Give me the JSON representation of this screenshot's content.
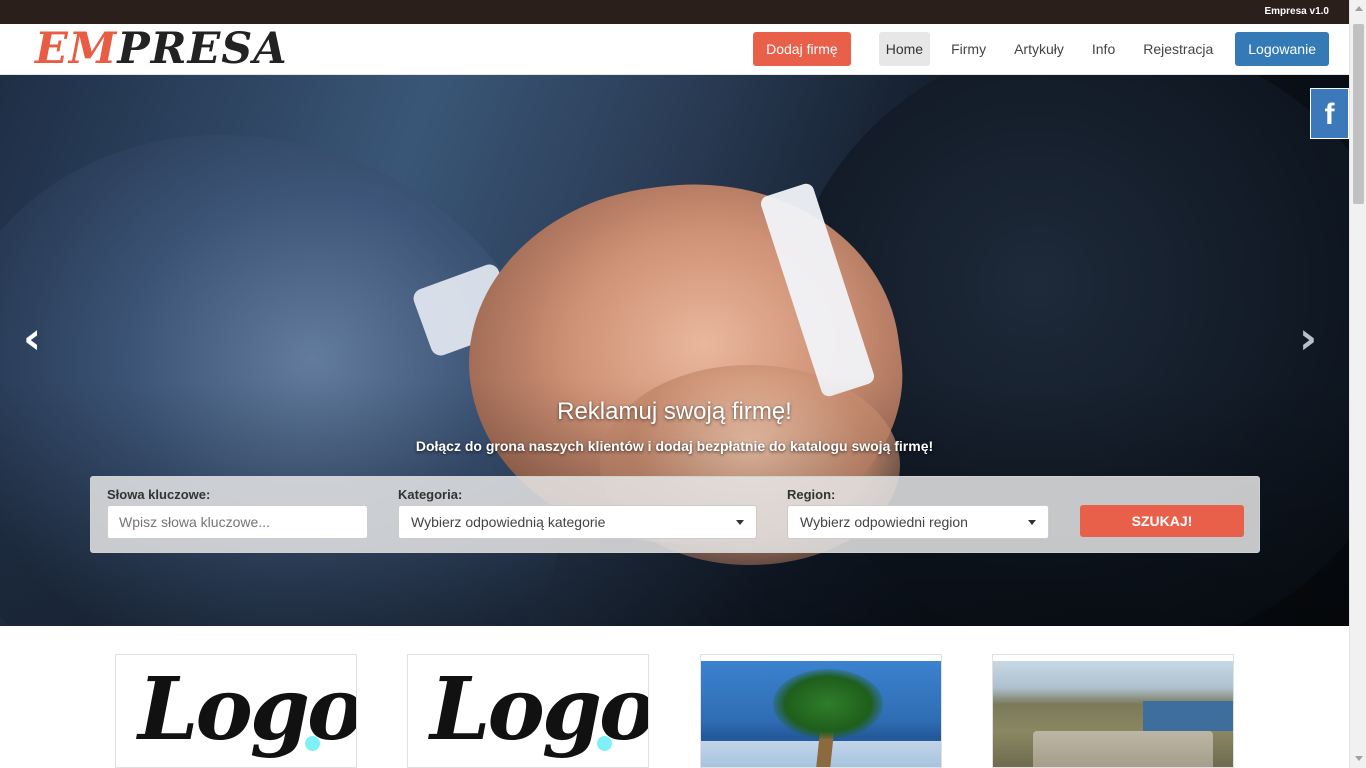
{
  "topbar": {
    "version": "Empresa v1.0"
  },
  "brand": {
    "part1": "EM",
    "part2": "PRESA"
  },
  "nav": {
    "add_company": "Dodaj firmę",
    "items": [
      {
        "label": "Home",
        "active": true
      },
      {
        "label": "Firmy",
        "active": false
      },
      {
        "label": "Artykuły",
        "active": false
      },
      {
        "label": "Info",
        "active": false
      },
      {
        "label": "Rejestracja",
        "active": false
      }
    ],
    "login": "Logowanie"
  },
  "social": {
    "facebook_icon": "f"
  },
  "carousel": {
    "prev_icon": "‹",
    "next_icon": "›",
    "title": "Reklamuj swoją firmę!",
    "subtitle": "Dołącz do grona naszych klientów i dodaj bezpłatnie do katalogu swoją firmę!"
  },
  "search": {
    "keywords_label": "Słowa kluczowe:",
    "keywords_placeholder": "Wpisz słowa kluczowe...",
    "category_label": "Kategoria:",
    "category_value": "Wybierz odpowiednią kategorie",
    "region_label": "Region:",
    "region_value": "Wybierz odpowiedni region",
    "submit": "SZUKAJ!"
  },
  "cards": [
    {
      "logo_text": "Logo"
    },
    {
      "logo_text": "Logo"
    }
  ],
  "colors": {
    "accent": "#e8604a",
    "primary": "#337ab7",
    "topbar": "#2b1f1c"
  }
}
